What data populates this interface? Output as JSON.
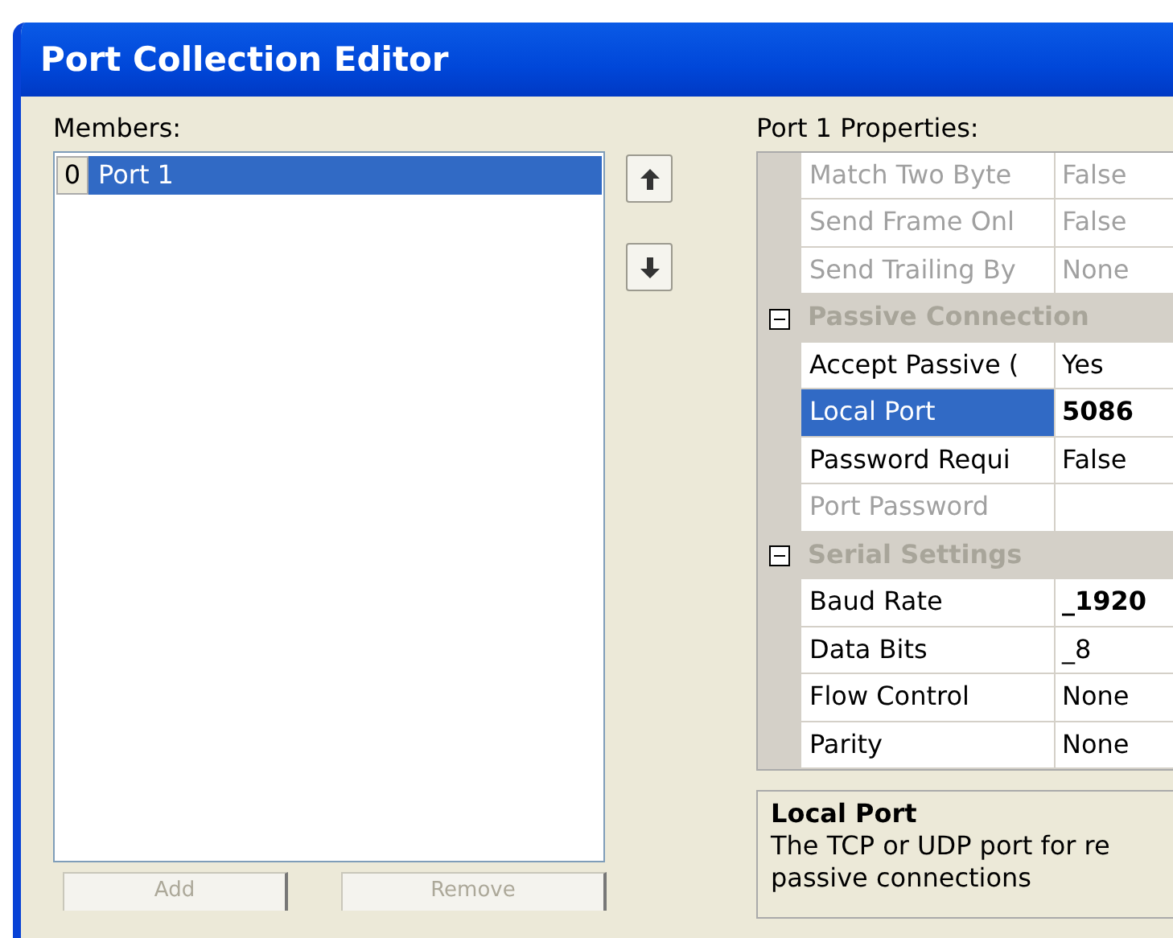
{
  "window": {
    "title": "Port Collection Editor"
  },
  "members": {
    "label": "Members:",
    "items": [
      {
        "index": "0",
        "name": "Port 1",
        "selected": true
      }
    ]
  },
  "move_buttons": [
    {
      "kind": "up"
    },
    {
      "kind": "down"
    }
  ],
  "properties": {
    "label": "Port 1 Properties:",
    "rows": [
      {
        "kind": "property",
        "name": "Match Two Byte",
        "value": "False",
        "disabled": true,
        "selected": false,
        "modified": false
      },
      {
        "kind": "property",
        "name": "Send Frame Onl",
        "value": "False",
        "disabled": true,
        "selected": false,
        "modified": false
      },
      {
        "kind": "property",
        "name": "Send Trailing By",
        "value": "None",
        "disabled": true,
        "selected": false,
        "modified": false
      },
      {
        "kind": "category",
        "name": "Passive Connection",
        "expanded": true
      },
      {
        "kind": "property",
        "name": "Accept Passive (",
        "value": "Yes",
        "disabled": false,
        "selected": false,
        "modified": false
      },
      {
        "kind": "property",
        "name": "Local Port",
        "value": "5086",
        "disabled": false,
        "selected": true,
        "modified": true
      },
      {
        "kind": "property",
        "name": "Password Requi",
        "value": "False",
        "disabled": false,
        "selected": false,
        "modified": false
      },
      {
        "kind": "property",
        "name": "Port Password",
        "disabled": true,
        "selected": false,
        "modified": false
      },
      {
        "kind": "category",
        "name": "Serial Settings",
        "expanded": true
      },
      {
        "kind": "property",
        "name": "Baud Rate",
        "value": "_1920",
        "disabled": false,
        "selected": false,
        "modified": true
      },
      {
        "kind": "property",
        "name": "Data Bits",
        "value": "_8",
        "disabled": false,
        "selected": false,
        "modified": false
      },
      {
        "kind": "property",
        "name": "Flow Control",
        "value": "None",
        "disabled": false,
        "selected": false,
        "modified": false
      },
      {
        "kind": "property",
        "name": "Parity",
        "value": "None",
        "disabled": false,
        "selected": false,
        "modified": false
      }
    ]
  },
  "description": {
    "title": "Local Port",
    "text": "The TCP or UDP port for re passive connections"
  },
  "buttons": [
    {
      "label": "Add",
      "disabled": true
    },
    {
      "label": "Remove",
      "disabled": true
    }
  ]
}
